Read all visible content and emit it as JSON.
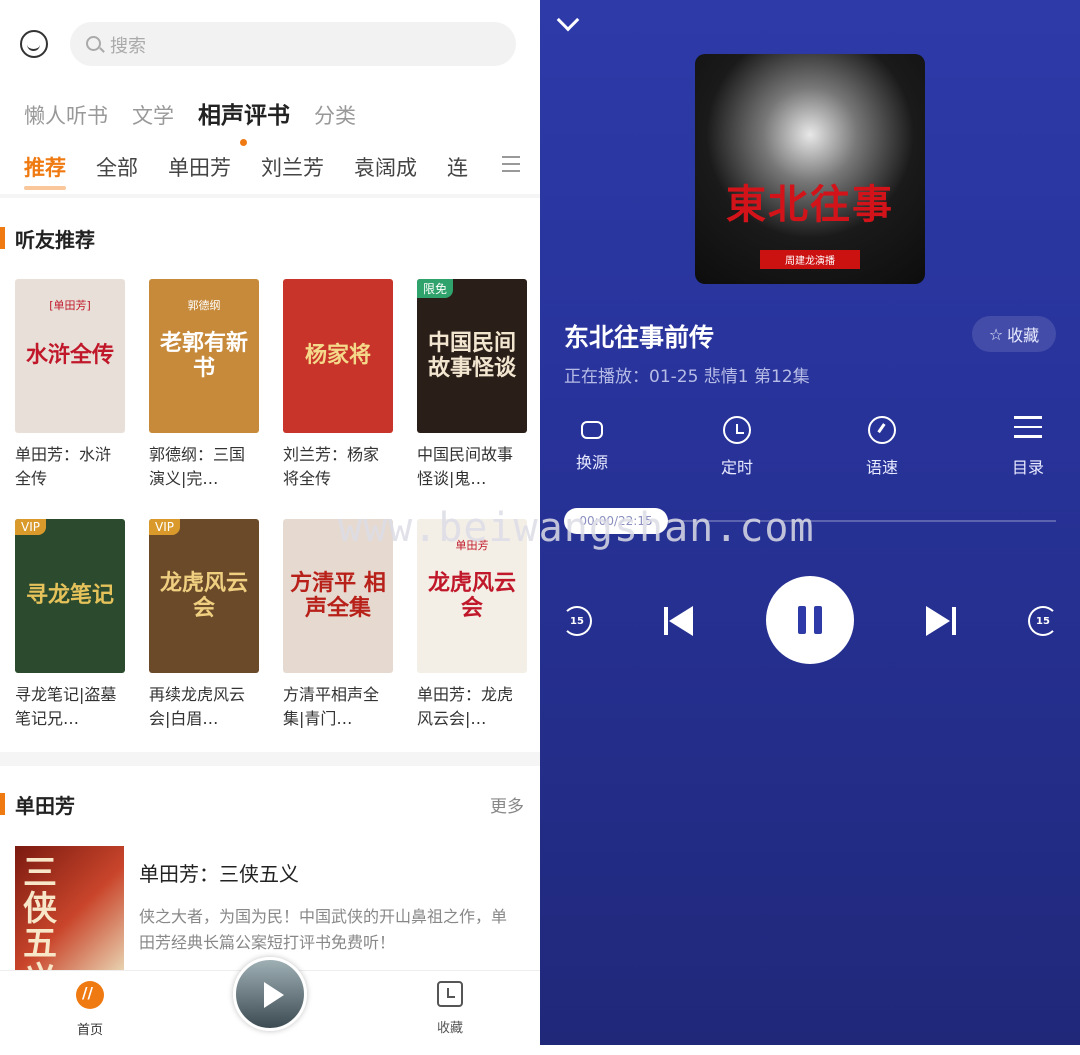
{
  "search": {
    "placeholder": "搜索"
  },
  "top_tabs": [
    "懒人听书",
    "文学",
    "相声评书",
    "分类"
  ],
  "sub_tabs": [
    "推荐",
    "全部",
    "单田芳",
    "刘兰芳",
    "袁阔成",
    "连"
  ],
  "section1": {
    "title": "听友推荐",
    "books": [
      {
        "cover": "水浒全传",
        "cover_sub": "[单田芳]",
        "title": "单田芳：水浒全传",
        "color": "#e8e0d8",
        "text_color": "#c0182a"
      },
      {
        "cover": "老郭有新书",
        "cover_sub": "郭德纲",
        "title": "郭德纲：三国演义|完…",
        "color": "#c78a3a",
        "text_color": "#ffffff"
      },
      {
        "cover": "杨家将",
        "cover_sub": "",
        "title": "刘兰芳：杨家将全传",
        "color": "#c8342a",
        "text_color": "#f5d98a"
      },
      {
        "cover": "中国民间故事怪谈",
        "cover_sub": "",
        "badge": "限免",
        "title": "中国民间故事怪谈|鬼…",
        "color": "#2a1e18",
        "text_color": "#f2e6d0"
      },
      {
        "cover": "寻龙笔记",
        "cover_sub": "",
        "badge": "VIP",
        "title": "寻龙笔记|盗墓笔记兄…",
        "color": "#2b4a2e",
        "text_color": "#e6c25a"
      },
      {
        "cover": "龙虎风云会",
        "cover_sub": "",
        "badge": "VIP",
        "title": "再续龙虎风云会|白眉…",
        "color": "#6b4a2a",
        "text_color": "#f0d080"
      },
      {
        "cover": "方清平 相声全集",
        "cover_sub": "",
        "title": "方清平相声全集|青门…",
        "color": "#e6dad0",
        "text_color": "#b8201a"
      },
      {
        "cover": "龙虎风云会",
        "cover_sub": "单田芳",
        "title": "单田芳：龙虎风云会|…",
        "color": "#f3efe6",
        "text_color": "#c0182a"
      }
    ]
  },
  "section2": {
    "title": "单田芳",
    "more": "更多",
    "feature": {
      "cover": "三侠五义",
      "title": "单田芳：三侠五义",
      "desc": "侠之大者，为国为民！中国武侠的开山鼻祖之作，单田芳经典长篇公案短打评书免费听！"
    }
  },
  "bottom_nav": {
    "home": "首页",
    "favorites": "收藏"
  },
  "player": {
    "album_title": "東北往事",
    "album_sub": "周建龙演播",
    "title": "东北往事前传",
    "now_playing": "正在播放：01-25 悲情1 第12集",
    "fav": "收藏",
    "controls": [
      "换源",
      "定时",
      "语速",
      "目录"
    ],
    "progress_time": "00:00/22:15",
    "rewind": "15",
    "forward": "15"
  },
  "watermark": "www.beiwangshan.com"
}
